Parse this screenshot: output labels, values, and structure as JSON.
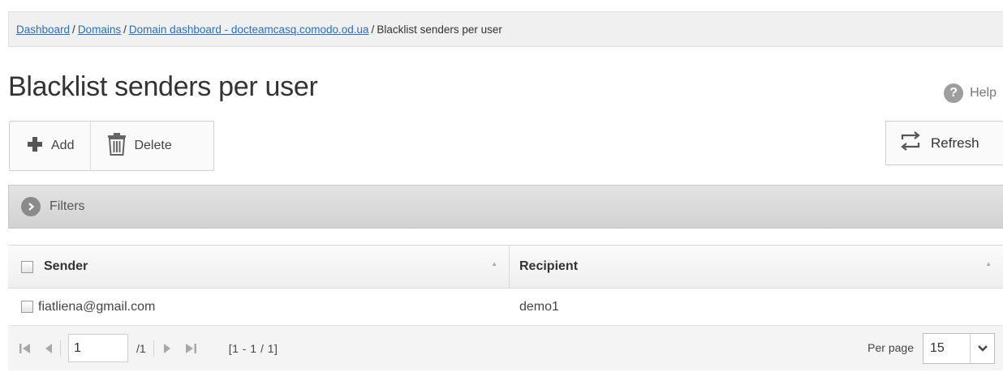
{
  "breadcrumb": {
    "items": [
      {
        "label": "Dashboard",
        "link": true
      },
      {
        "label": "Domains",
        "link": true
      },
      {
        "label": "Domain dashboard - docteamcasq.comodo.od.ua",
        "link": true
      },
      {
        "label": "Blacklist senders per user",
        "link": false
      }
    ],
    "separator": "/"
  },
  "page": {
    "title": "Blacklist senders per user",
    "help_label": "Help",
    "help_icon_glyph": "?"
  },
  "toolbar": {
    "add_label": "Add",
    "delete_label": "Delete",
    "refresh_label": "Refresh"
  },
  "filters": {
    "label": "Filters"
  },
  "table": {
    "columns": [
      "Sender",
      "Recipient"
    ],
    "rows": [
      {
        "sender": "fiatliena@gmail.com",
        "recipient": "demo1"
      }
    ]
  },
  "pager": {
    "current_page": "1",
    "total_pages": "/1",
    "range": "[1 - 1 / 1]",
    "per_page_label": "Per page",
    "per_page_value": "15"
  },
  "colors": {
    "link": "#2a6ebb",
    "filters_bar": "#d9d9d9",
    "icon_grey": "#8a8a8a"
  }
}
